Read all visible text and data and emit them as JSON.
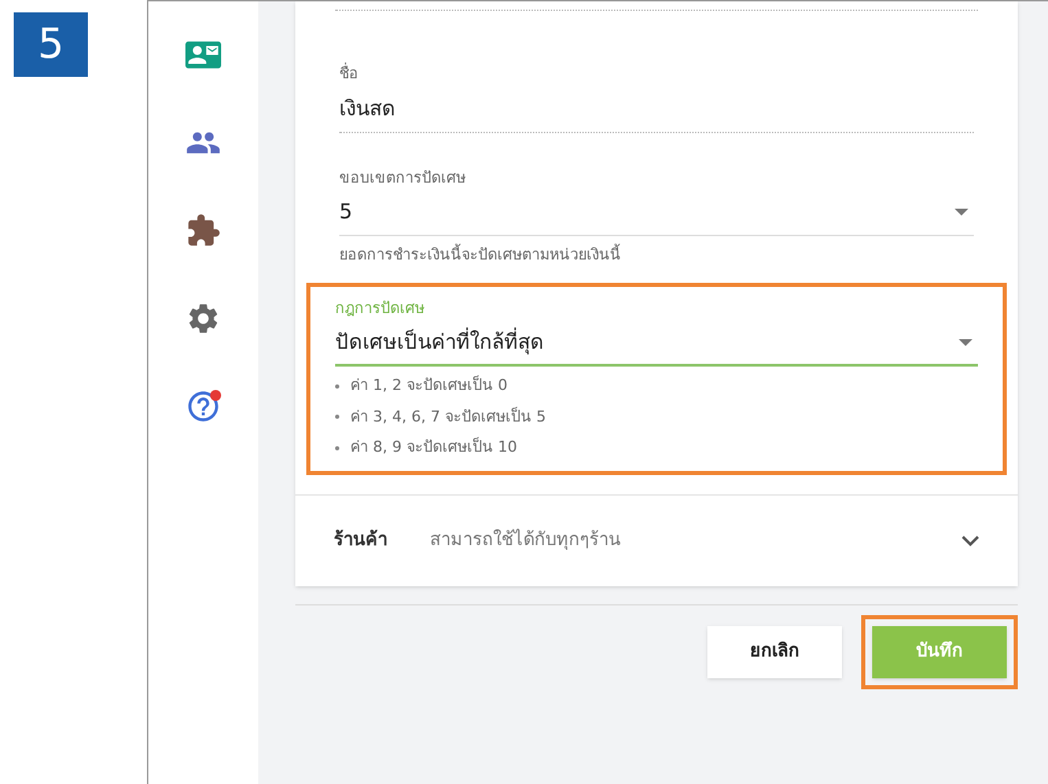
{
  "step_number": "5",
  "fields": [
    {
      "kind": "text",
      "label": "ชื่อ",
      "value": "เงินสด",
      "focused": false,
      "highlighted": false
    },
    {
      "kind": "select",
      "label": "ขอบเขตการปัดเศษ",
      "value": "5",
      "helper": "ยอดการชำระเงินนี้จะปัดเศษตามหน่วยเงินนี้",
      "focused": false,
      "highlighted": false
    },
    {
      "kind": "select",
      "label": "กฎการปัดเศษ",
      "value": "ปัดเศษเป็นค่าที่ใกล้ที่สุด",
      "focused": true,
      "highlighted": true,
      "notes": [
        "ค่า 1, 2 จะปัดเศษเป็น 0",
        "ค่า 3, 4, 6, 7 จะปัดเศษเป็น 5",
        "ค่า 8, 9 จะปัดเศษเป็น 10"
      ]
    }
  ],
  "store_row": {
    "label": "ร้านค้า",
    "value": "สามารถใช้ได้กับทุกๆร้าน"
  },
  "buttons": [
    {
      "kind": "cancel",
      "label": "ยกเลิก",
      "highlighted": false
    },
    {
      "kind": "save",
      "label": "บันทึก",
      "highlighted": true
    }
  ]
}
